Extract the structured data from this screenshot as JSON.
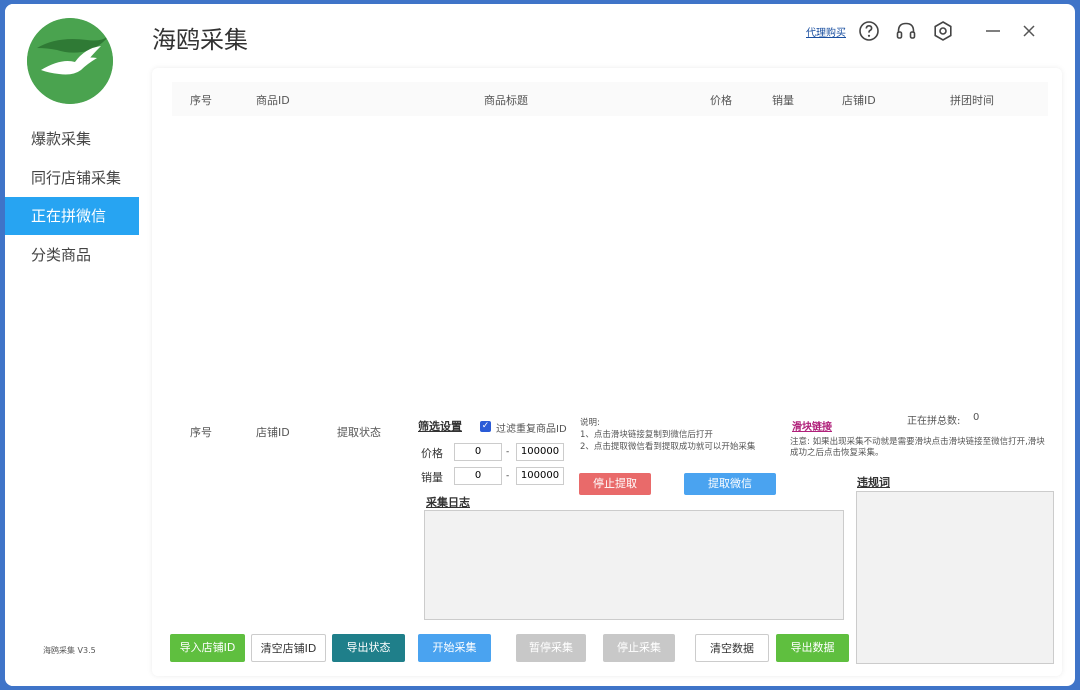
{
  "app": {
    "title": "海鸥采集",
    "version": "海鸥采集 V3.5"
  },
  "topbar": {
    "buy_link": "代理购买"
  },
  "sidebar": {
    "items": [
      {
        "label": "爆款采集"
      },
      {
        "label": "同行店铺采集"
      },
      {
        "label": "正在拼微信",
        "active": true
      },
      {
        "label": "分类商品"
      }
    ]
  },
  "main_table": {
    "columns": [
      "序号",
      "商品ID",
      "商品标题",
      "价格",
      "销量",
      "店铺ID",
      "拼团时间"
    ],
    "rows": []
  },
  "shop_table": {
    "columns": [
      "序号",
      "店铺ID",
      "提取状态"
    ],
    "rows": []
  },
  "filter": {
    "title": "筛选设置",
    "dedupe_label": "过滤重复商品ID",
    "dedupe_checked": true,
    "price_label": "价格",
    "price_min": "0",
    "price_max": "100000",
    "sales_label": "销量",
    "sales_min": "0",
    "sales_max": "100000",
    "separator": "-"
  },
  "instructions": {
    "title": "说明:",
    "line1": "1、点击滑块链接复制到微信后打开",
    "line2": "2、点击提取微信看到提取成功就可以开始采集"
  },
  "slider": {
    "link": "滑块链接",
    "count_label": "正在拼总数:",
    "count": "0",
    "note": "注意: 如果出现采集不动就是需要滑块点击滑块链接至微信打开,滑块成功之后点击恢复采集。"
  },
  "actions": {
    "stop_extract": "停止提取",
    "extract_wechat": "提取微信"
  },
  "log": {
    "title": "采集日志"
  },
  "banned": {
    "title": "违规词"
  },
  "bottom_buttons": {
    "import_shop": "导入店铺ID",
    "clear_shop": "清空店铺ID",
    "export_status": "导出状态",
    "start": "开始采集",
    "pause": "暂停采集",
    "stop": "停止采集",
    "clear_data": "清空数据",
    "export_data": "导出数据"
  },
  "colors": {
    "accent": "#27a4f2",
    "green": "#5fbf3f",
    "teal": "#1f7f8a",
    "red": "#e96a6a",
    "blue": "#4aa3f0",
    "disabled": "#c8c8c8"
  }
}
